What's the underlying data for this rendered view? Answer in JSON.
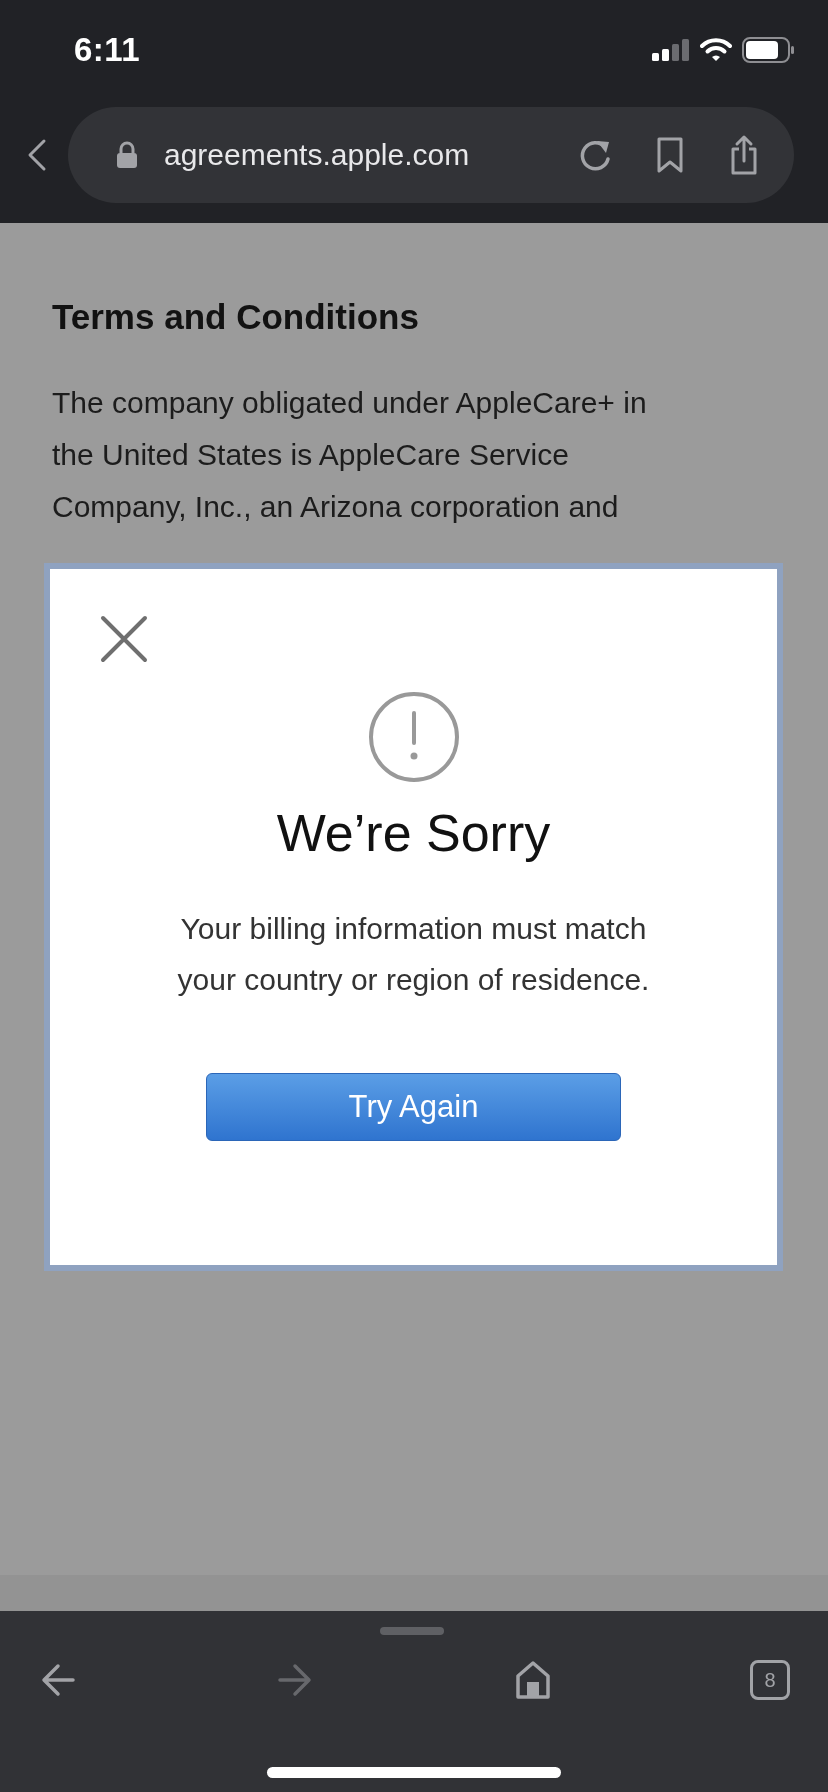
{
  "status_bar": {
    "time": "6:11"
  },
  "browser": {
    "url": "agreements.apple.com"
  },
  "page": {
    "heading": "Terms and Conditions",
    "paragraph_lines": [
      "The company obligated under AppleCare+ in",
      "the United States is AppleCare Service",
      "Company, Inc., an Arizona corporation and"
    ]
  },
  "dialog": {
    "title": "We’re Sorry",
    "message_lines": [
      "Your billing information must match",
      "your country or region of residence."
    ],
    "button": "Try Again"
  },
  "toolbar": {
    "items": [
      {
        "kind": "back",
        "disabled": false
      },
      {
        "kind": "forward",
        "disabled": true
      },
      {
        "kind": "home",
        "disabled": false
      },
      {
        "kind": "tabs",
        "disabled": false,
        "count": "8"
      }
    ]
  }
}
